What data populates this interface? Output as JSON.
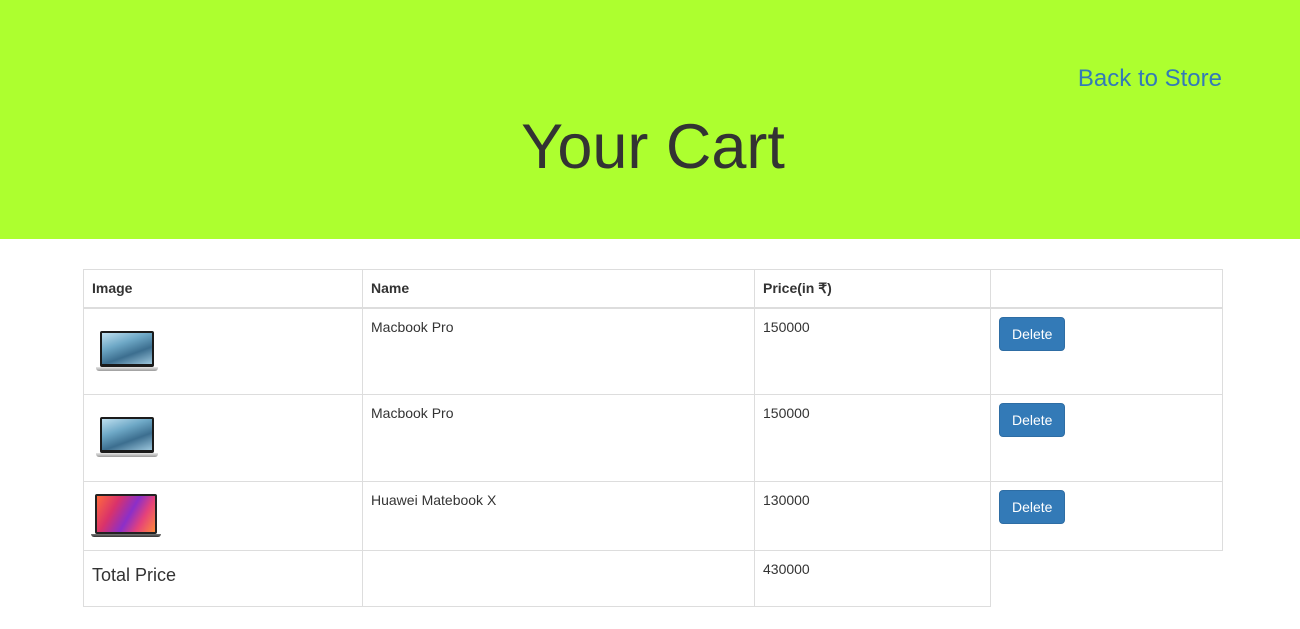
{
  "header": {
    "title": "Your Cart",
    "back_link": "Back to Store",
    "background_color": "#adff2f",
    "link_color": "#337ab7"
  },
  "table": {
    "columns": [
      "Image",
      "Name",
      "Price(in ₹)",
      ""
    ],
    "rows": [
      {
        "image_icon": "macbook-pro-thumbnail",
        "name": "Macbook Pro",
        "price": "150000",
        "action": "Delete"
      },
      {
        "image_icon": "macbook-pro-thumbnail",
        "name": "Macbook Pro",
        "price": "150000",
        "action": "Delete"
      },
      {
        "image_icon": "huawei-matebook-x-thumbnail",
        "name": "Huawei Matebook X",
        "price": "130000",
        "action": "Delete"
      }
    ],
    "total": {
      "label": "Total Price",
      "value": "430000"
    }
  },
  "colors": {
    "button": "#337ab7",
    "text": "#333333",
    "border": "#dddddd"
  }
}
